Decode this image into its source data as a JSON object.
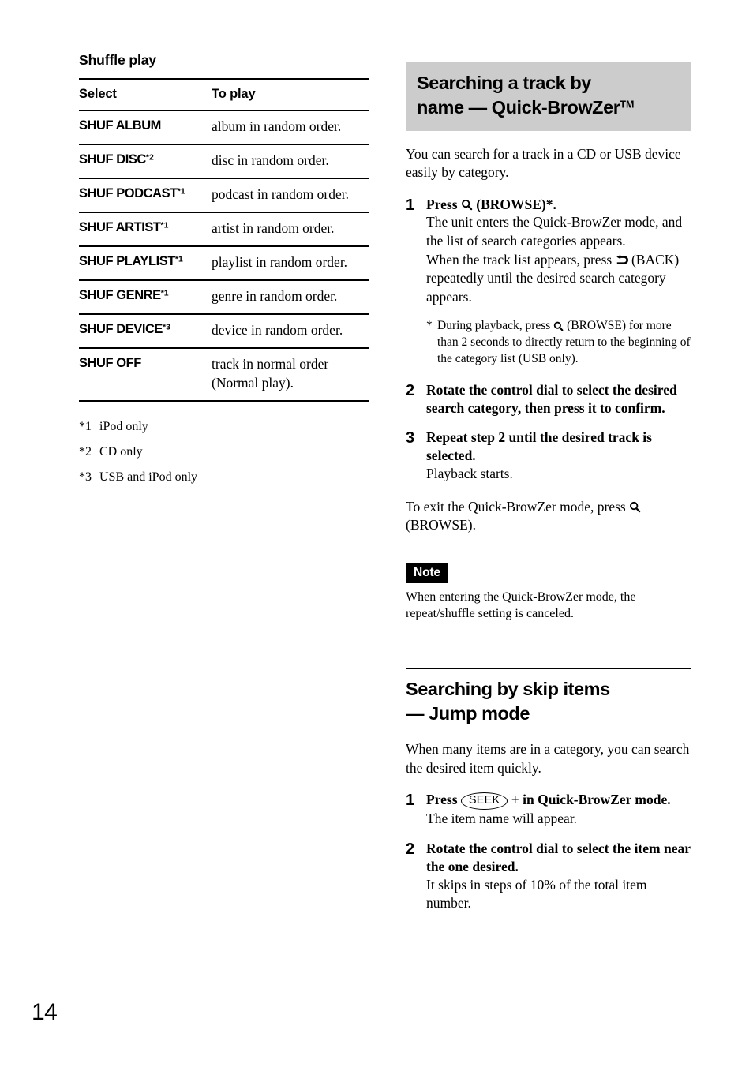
{
  "page": {
    "number": "14"
  },
  "left_column": {
    "subheading": "Shuffle play",
    "table": {
      "headers": [
        "Select",
        "To play"
      ],
      "rows": [
        {
          "select": "SHUF ALBUM",
          "footnote": "",
          "to_play": "album in random order."
        },
        {
          "select": "SHUF DISC",
          "footnote": "*2",
          "to_play": "disc in random order."
        },
        {
          "select": "SHUF PODCAST",
          "footnote": "*1",
          "to_play": "podcast in random order."
        },
        {
          "select": "SHUF ARTIST",
          "footnote": "*1",
          "to_play": "artist in random order."
        },
        {
          "select": "SHUF PLAYLIST",
          "footnote": "*1",
          "to_play": "playlist in random order."
        },
        {
          "select": "SHUF GENRE",
          "footnote": "*1",
          "to_play": "genre in random order."
        },
        {
          "select": "SHUF DEVICE",
          "footnote": "*3",
          "to_play": "device in random order."
        },
        {
          "select": "SHUF OFF",
          "footnote": "",
          "to_play": "track in normal order (Normal play)."
        }
      ]
    },
    "footnotes": [
      {
        "mark": "*1",
        "text": "iPod only"
      },
      {
        "mark": "*2",
        "text": "CD only"
      },
      {
        "mark": "*3",
        "text": "USB and iPod only"
      }
    ]
  },
  "right_column": {
    "section1": {
      "heading_line1": "Searching a track by",
      "heading_line2": "name — Quick-BrowZer",
      "heading_trademark": "TM",
      "intro": "You can search for a track in a CD or USB device easily by category.",
      "steps": [
        {
          "number": "1",
          "lead_prefix": "Press ",
          "lead_icon": "magnifier-browse-icon",
          "lead_suffix": " (BROWSE)*.",
          "sub_part1": "The unit enters the Quick-BrowZer mode, and the list of search categories appears.",
          "sub_part2_prefix": "When the track list appears, press ",
          "sub_part2_icon": "back-arrow-icon",
          "sub_part2_suffix": " (BACK) repeatedly until the desired search category appears."
        },
        {
          "number": "2",
          "lead": "Rotate the control dial to select the desired search category, then press it to confirm."
        },
        {
          "number": "3",
          "lead": "Repeat step 2 until the desired track is selected.",
          "sub": "Playback starts."
        }
      ],
      "star_note": {
        "mark": "*",
        "prefix": "During playback, press ",
        "icon": "magnifier-browse-icon",
        "suffix": " (BROWSE) for more than 2 seconds to directly return to the beginning of the category list (USB only)."
      },
      "exit_prefix": "To exit the Quick-BrowZer mode, press ",
      "exit_icon": "magnifier-browse-icon",
      "exit_suffix": " (BROWSE).",
      "note_label": "Note",
      "note_text": "When entering the Quick-BrowZer mode, the repeat/shuffle setting is canceled."
    },
    "section2": {
      "heading_line1": "Searching by skip items",
      "heading_line2": "— Jump mode",
      "intro": "When many items are in a category, you can search the desired item quickly.",
      "steps": [
        {
          "number": "1",
          "lead_prefix": "Press ",
          "lead_button": "SEEK",
          "lead_suffix": " + in Quick-BrowZer mode.",
          "sub": "The item name will appear."
        },
        {
          "number": "2",
          "lead": "Rotate the control dial to select the item near the one desired.",
          "sub": "It skips in steps of 10% of the total item number."
        }
      ]
    }
  },
  "colors": {
    "banner_background": "#cccccc",
    "note_badge_background": "#000000",
    "text": "#000000"
  }
}
